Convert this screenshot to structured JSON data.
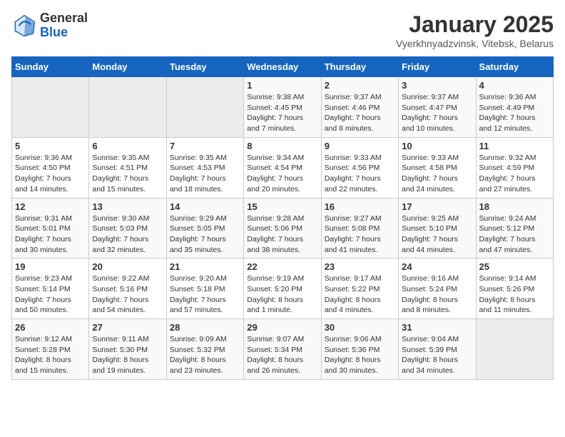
{
  "logo": {
    "general": "General",
    "blue": "Blue"
  },
  "header": {
    "title": "January 2025",
    "subtitle": "Vyerkhnyadzvinsk, Vitebsk, Belarus"
  },
  "weekdays": [
    "Sunday",
    "Monday",
    "Tuesday",
    "Wednesday",
    "Thursday",
    "Friday",
    "Saturday"
  ],
  "weeks": [
    [
      {
        "day": "",
        "detail": ""
      },
      {
        "day": "",
        "detail": ""
      },
      {
        "day": "",
        "detail": ""
      },
      {
        "day": "1",
        "detail": "Sunrise: 9:38 AM\nSunset: 4:45 PM\nDaylight: 7 hours\nand 7 minutes."
      },
      {
        "day": "2",
        "detail": "Sunrise: 9:37 AM\nSunset: 4:46 PM\nDaylight: 7 hours\nand 8 minutes."
      },
      {
        "day": "3",
        "detail": "Sunrise: 9:37 AM\nSunset: 4:47 PM\nDaylight: 7 hours\nand 10 minutes."
      },
      {
        "day": "4",
        "detail": "Sunrise: 9:36 AM\nSunset: 4:49 PM\nDaylight: 7 hours\nand 12 minutes."
      }
    ],
    [
      {
        "day": "5",
        "detail": "Sunrise: 9:36 AM\nSunset: 4:50 PM\nDaylight: 7 hours\nand 14 minutes."
      },
      {
        "day": "6",
        "detail": "Sunrise: 9:35 AM\nSunset: 4:51 PM\nDaylight: 7 hours\nand 15 minutes."
      },
      {
        "day": "7",
        "detail": "Sunrise: 9:35 AM\nSunset: 4:53 PM\nDaylight: 7 hours\nand 18 minutes."
      },
      {
        "day": "8",
        "detail": "Sunrise: 9:34 AM\nSunset: 4:54 PM\nDaylight: 7 hours\nand 20 minutes."
      },
      {
        "day": "9",
        "detail": "Sunrise: 9:33 AM\nSunset: 4:56 PM\nDaylight: 7 hours\nand 22 minutes."
      },
      {
        "day": "10",
        "detail": "Sunrise: 9:33 AM\nSunset: 4:58 PM\nDaylight: 7 hours\nand 24 minutes."
      },
      {
        "day": "11",
        "detail": "Sunrise: 9:32 AM\nSunset: 4:59 PM\nDaylight: 7 hours\nand 27 minutes."
      }
    ],
    [
      {
        "day": "12",
        "detail": "Sunrise: 9:31 AM\nSunset: 5:01 PM\nDaylight: 7 hours\nand 30 minutes."
      },
      {
        "day": "13",
        "detail": "Sunrise: 9:30 AM\nSunset: 5:03 PM\nDaylight: 7 hours\nand 32 minutes."
      },
      {
        "day": "14",
        "detail": "Sunrise: 9:29 AM\nSunset: 5:05 PM\nDaylight: 7 hours\nand 35 minutes."
      },
      {
        "day": "15",
        "detail": "Sunrise: 9:28 AM\nSunset: 5:06 PM\nDaylight: 7 hours\nand 38 minutes."
      },
      {
        "day": "16",
        "detail": "Sunrise: 9:27 AM\nSunset: 5:08 PM\nDaylight: 7 hours\nand 41 minutes."
      },
      {
        "day": "17",
        "detail": "Sunrise: 9:25 AM\nSunset: 5:10 PM\nDaylight: 7 hours\nand 44 minutes."
      },
      {
        "day": "18",
        "detail": "Sunrise: 9:24 AM\nSunset: 5:12 PM\nDaylight: 7 hours\nand 47 minutes."
      }
    ],
    [
      {
        "day": "19",
        "detail": "Sunrise: 9:23 AM\nSunset: 5:14 PM\nDaylight: 7 hours\nand 50 minutes."
      },
      {
        "day": "20",
        "detail": "Sunrise: 9:22 AM\nSunset: 5:16 PM\nDaylight: 7 hours\nand 54 minutes."
      },
      {
        "day": "21",
        "detail": "Sunrise: 9:20 AM\nSunset: 5:18 PM\nDaylight: 7 hours\nand 57 minutes."
      },
      {
        "day": "22",
        "detail": "Sunrise: 9:19 AM\nSunset: 5:20 PM\nDaylight: 8 hours\nand 1 minute."
      },
      {
        "day": "23",
        "detail": "Sunrise: 9:17 AM\nSunset: 5:22 PM\nDaylight: 8 hours\nand 4 minutes."
      },
      {
        "day": "24",
        "detail": "Sunrise: 9:16 AM\nSunset: 5:24 PM\nDaylight: 8 hours\nand 8 minutes."
      },
      {
        "day": "25",
        "detail": "Sunrise: 9:14 AM\nSunset: 5:26 PM\nDaylight: 8 hours\nand 11 minutes."
      }
    ],
    [
      {
        "day": "26",
        "detail": "Sunrise: 9:12 AM\nSunset: 5:28 PM\nDaylight: 8 hours\nand 15 minutes."
      },
      {
        "day": "27",
        "detail": "Sunrise: 9:11 AM\nSunset: 5:30 PM\nDaylight: 8 hours\nand 19 minutes."
      },
      {
        "day": "28",
        "detail": "Sunrise: 9:09 AM\nSunset: 5:32 PM\nDaylight: 8 hours\nand 23 minutes."
      },
      {
        "day": "29",
        "detail": "Sunrise: 9:07 AM\nSunset: 5:34 PM\nDaylight: 8 hours\nand 26 minutes."
      },
      {
        "day": "30",
        "detail": "Sunrise: 9:06 AM\nSunset: 5:36 PM\nDaylight: 8 hours\nand 30 minutes."
      },
      {
        "day": "31",
        "detail": "Sunrise: 9:04 AM\nSunset: 5:39 PM\nDaylight: 8 hours\nand 34 minutes."
      },
      {
        "day": "",
        "detail": ""
      }
    ]
  ]
}
